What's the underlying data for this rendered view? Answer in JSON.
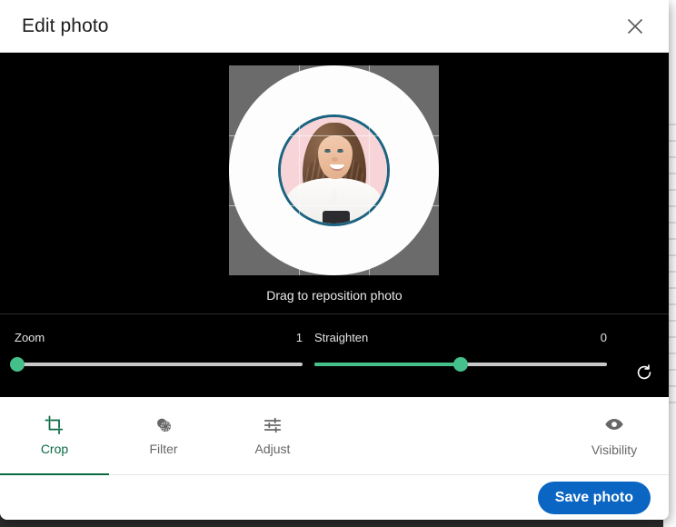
{
  "header": {
    "title": "Edit photo",
    "close_label": "Close"
  },
  "editor": {
    "hint": "Drag to reposition photo",
    "crop_shape": "circle",
    "ring_color": "#1b6380",
    "mask_color": "#6b6b6b",
    "canvas_bg": "#000000"
  },
  "sliders": {
    "zoom": {
      "label": "Zoom",
      "value": "1",
      "fill_percent": 0,
      "knob_percent": 1
    },
    "straighten": {
      "label": "Straighten",
      "value": "0",
      "fill_percent": 50,
      "knob_percent": 50
    },
    "reset_label": "Reset",
    "track_color": "#c9c9c9",
    "accent_color": "#46c08a"
  },
  "tools": {
    "active": "Crop",
    "items": [
      {
        "label": "Crop",
        "icon": "crop-icon",
        "active": true
      },
      {
        "label": "Filter",
        "icon": "filter-icon",
        "active": false
      },
      {
        "label": "Adjust",
        "icon": "adjust-icon",
        "active": false
      }
    ],
    "visibility": {
      "label": "Visibility",
      "icon": "eye-icon"
    },
    "active_color": "#0a6b42",
    "inactive_color": "#676767"
  },
  "footer": {
    "save_label": "Save photo",
    "save_color": "#0a66c2"
  }
}
